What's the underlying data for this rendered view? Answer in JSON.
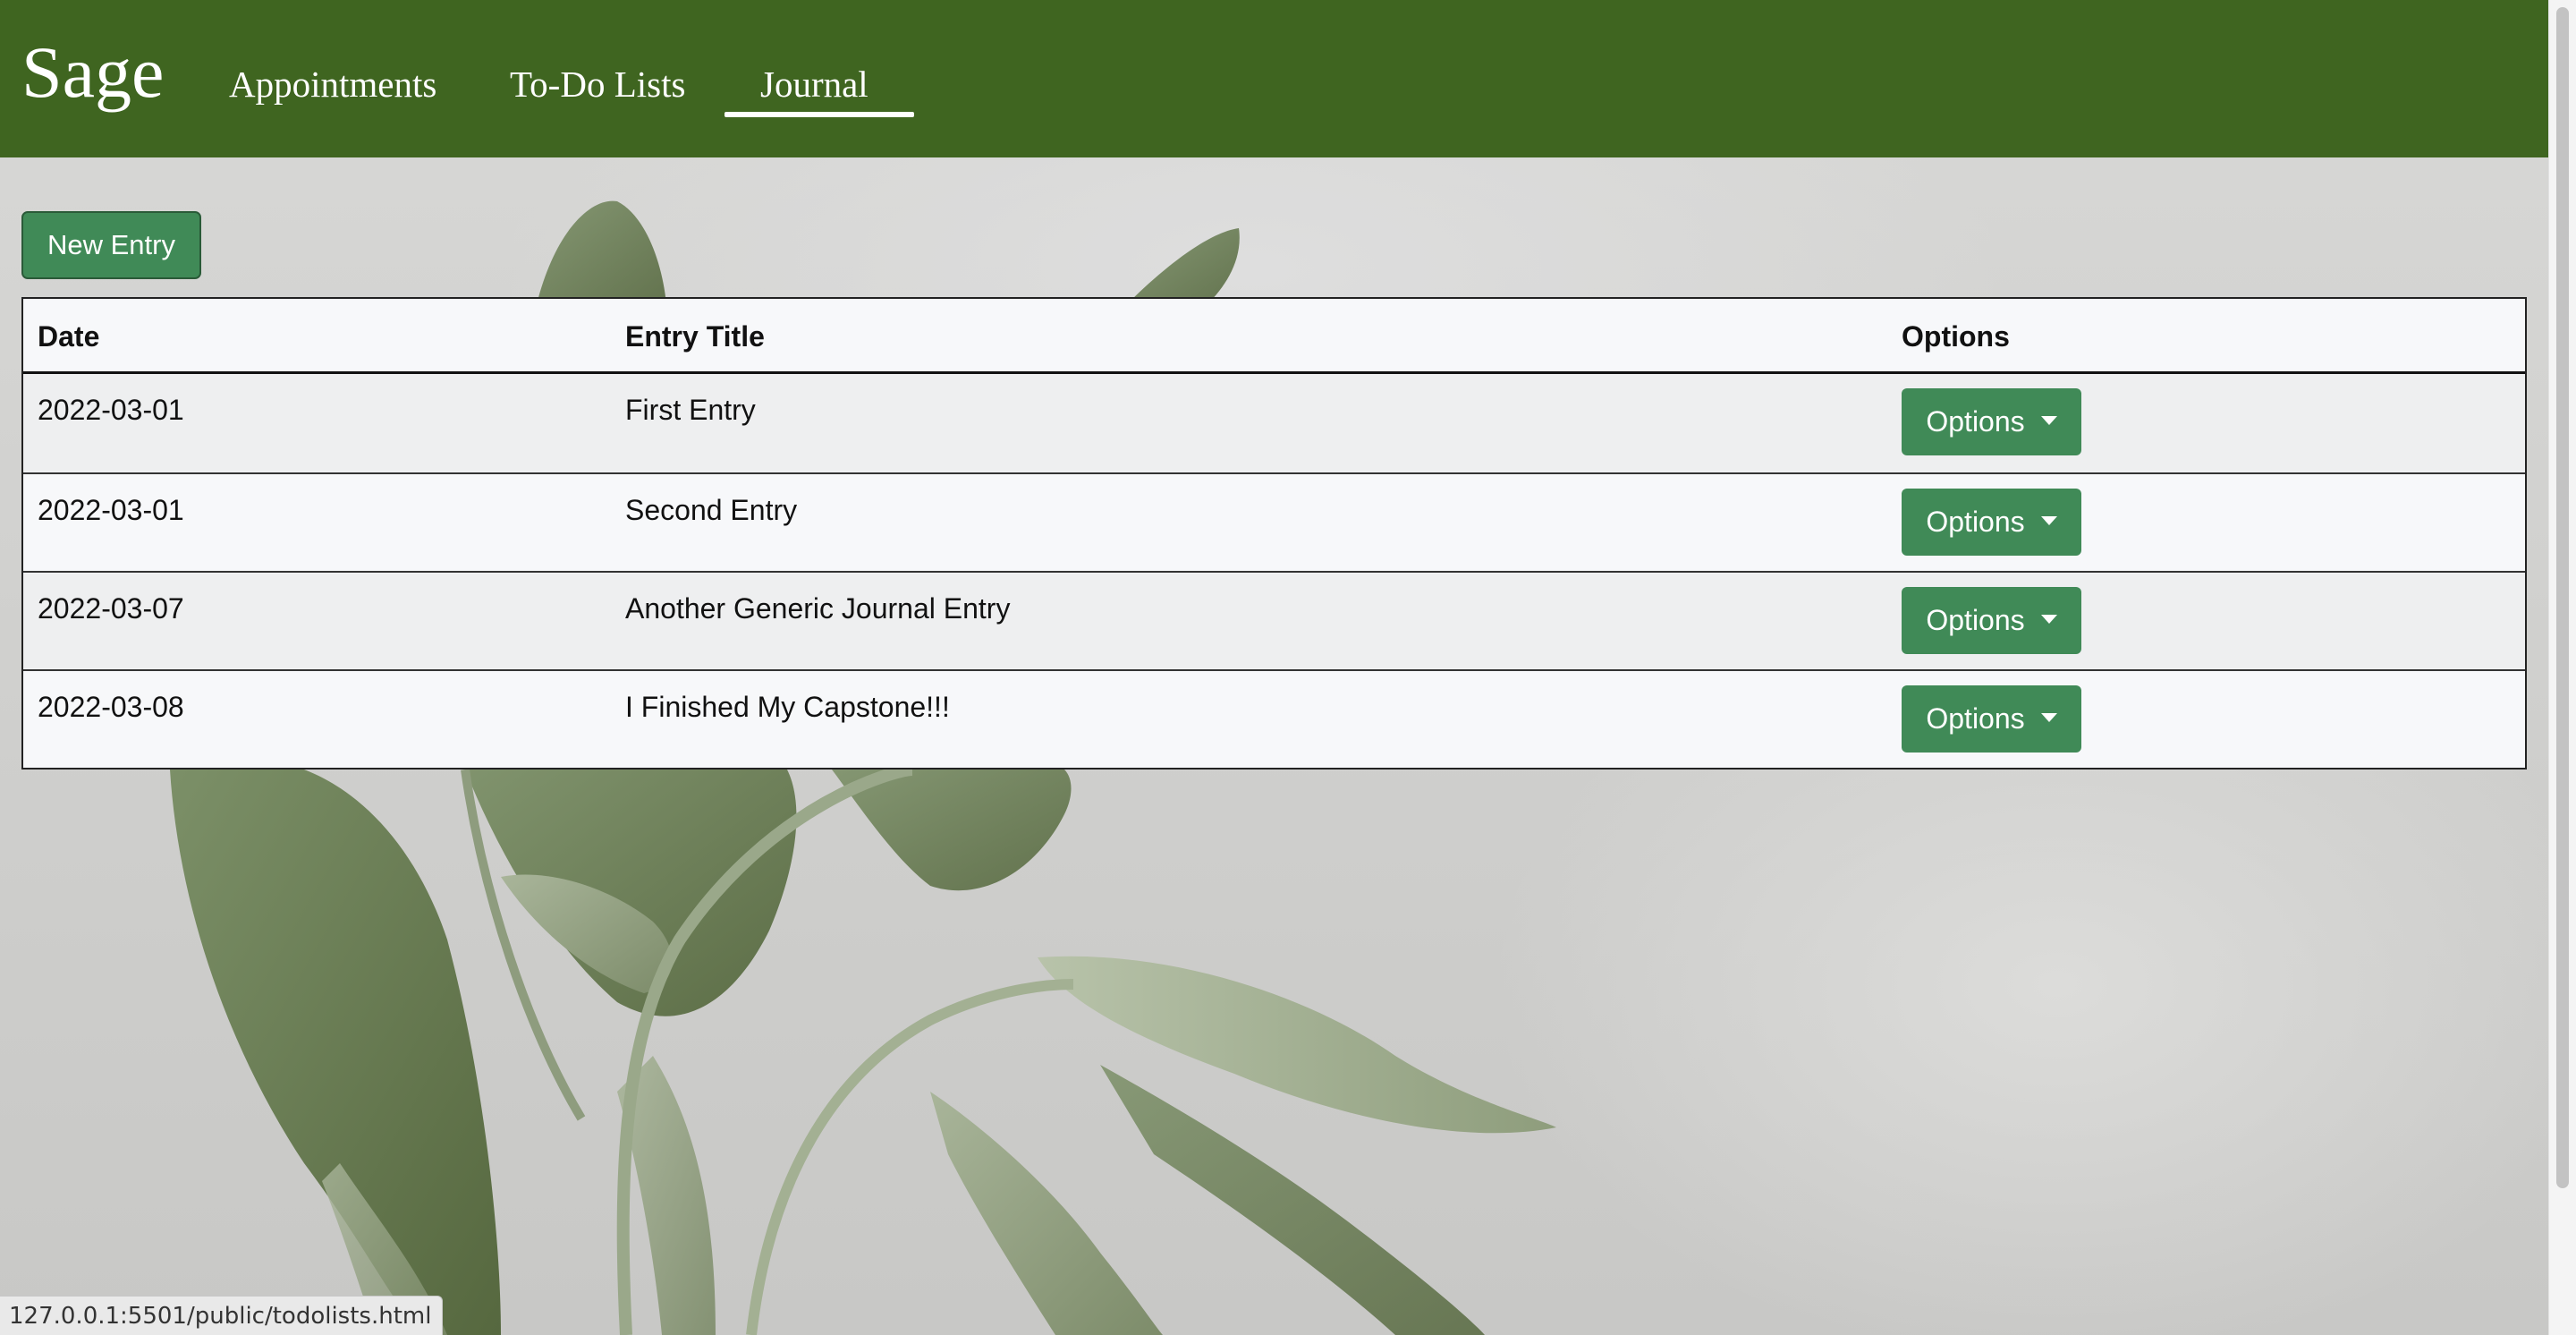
{
  "navbar": {
    "brand": "Sage",
    "links": [
      {
        "label": "Appointments"
      },
      {
        "label": "To-Do Lists"
      },
      {
        "label": "Journal",
        "active": true
      }
    ]
  },
  "actions": {
    "new_entry_label": "New Entry"
  },
  "table": {
    "headers": [
      "Date",
      "Entry Title",
      "Options"
    ],
    "rows": [
      {
        "date": "2022-03-01",
        "title": "First Entry",
        "options_label": "Options"
      },
      {
        "date": "2022-03-01",
        "title": "Second Entry",
        "options_label": "Options"
      },
      {
        "date": "2022-03-07",
        "title": "Another Generic Journal Entry",
        "options_label": "Options"
      },
      {
        "date": "2022-03-08",
        "title": "I Finished My Capstone!!!",
        "options_label": "Options"
      }
    ]
  },
  "statusbar": {
    "url": "127.0.0.1:5501/public/todolists.html"
  },
  "colors": {
    "navbar": "#3f6520",
    "button": "#408a57",
    "row_odd": "#eeeff0",
    "row_even": "#f7f8fa"
  },
  "icons": {
    "dropdown": "caret-down-icon"
  }
}
